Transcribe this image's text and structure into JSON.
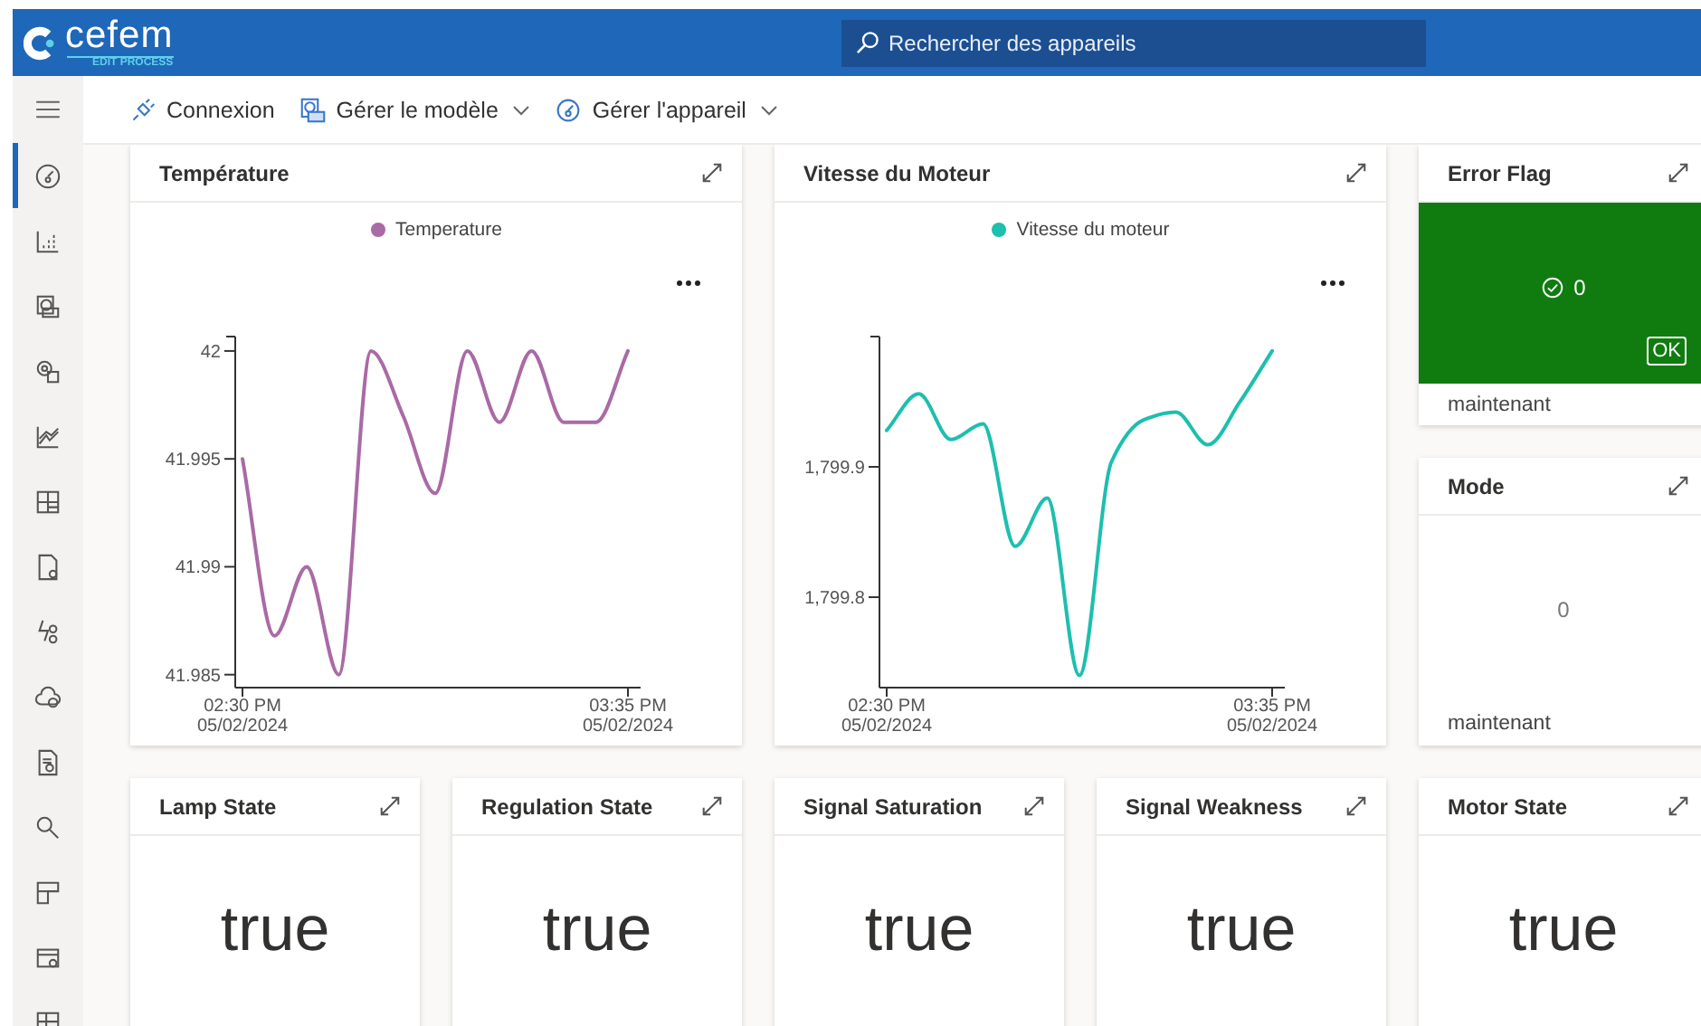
{
  "header": {
    "logo": {
      "name": "cefem",
      "tagline": "EDIT PROCESS"
    },
    "search": {
      "placeholder": "Rechercher des appareils"
    }
  },
  "sidebar": {
    "items": [
      {
        "selected": true
      },
      {
        "selected": false
      },
      {
        "selected": false
      },
      {
        "selected": false
      },
      {
        "selected": false
      },
      {
        "selected": false
      },
      {
        "selected": false
      },
      {
        "selected": false
      },
      {
        "selected": false
      },
      {
        "selected": false
      },
      {
        "selected": false
      },
      {
        "selected": false
      },
      {
        "selected": false
      },
      {
        "selected": false
      }
    ]
  },
  "commands": [
    {
      "label": "Connexion",
      "has_menu": false
    },
    {
      "label": "Gérer le modèle",
      "has_menu": true
    },
    {
      "label": "Gérer l'appareil",
      "has_menu": true
    }
  ],
  "charts": [
    {
      "title": "Température",
      "chart_data": {
        "type": "line",
        "categories": [
          "02:30 PM\n05/02/2024",
          null,
          null,
          null,
          null,
          null,
          null,
          null,
          null,
          null,
          null,
          null,
          "03:35 PM\n05/02/2024"
        ],
        "series": [
          {
            "name": "Temperature",
            "color": "#a96aa5",
            "values": [
              41.995,
              41.9868,
              41.99,
              41.985,
              42.0,
              41.997,
              41.9934,
              42.0,
              41.9967,
              42.0,
              41.9967,
              41.9967,
              42.0
            ]
          }
        ],
        "ylim": [
          41.9844,
          42.0005
        ],
        "yticks": [
          {
            "value": 41.985,
            "label": "41.985"
          },
          {
            "value": 41.99,
            "label": "41.99"
          },
          {
            "value": 41.995,
            "label": "41.995"
          },
          {
            "value": 42,
            "label": "42"
          }
        ]
      }
    },
    {
      "title": "Vitesse du Moteur",
      "chart_data": {
        "type": "line",
        "categories": [
          "02:30 PM\n05/02/2024",
          null,
          null,
          null,
          null,
          null,
          null,
          null,
          null,
          null,
          null,
          null,
          "03:35 PM\n05/02/2024"
        ],
        "series": [
          {
            "name": "Vitesse du moteur",
            "color": "#1dbfae",
            "values": [
              1799.928,
              1799.956,
              1799.921,
              1799.933,
              1799.839,
              1799.876,
              1799.74,
              1799.904,
              1799.936,
              1799.942,
              1799.917,
              1799.95,
              1799.989
            ]
          }
        ],
        "ylim": [
          1799.7306,
          1799.9972
        ],
        "yticks": [
          {
            "value": 1799.8,
            "label": "1,799.8"
          },
          {
            "value": 1799.9,
            "label": "1,799.9"
          }
        ]
      }
    }
  ],
  "side_tiles": [
    {
      "kind": "flag",
      "title": "Error Flag",
      "value": "0",
      "ok": true,
      "badge": "OK",
      "footer": "maintenant"
    },
    {
      "kind": "value",
      "title": "Mode",
      "value": "0",
      "footer": "maintenant"
    }
  ],
  "state_tiles": [
    {
      "title": "Lamp State",
      "value": "true"
    },
    {
      "title": "Regulation State",
      "value": "true"
    },
    {
      "title": "Signal Saturation",
      "value": "true"
    },
    {
      "title": "Signal Weakness",
      "value": "true"
    },
    {
      "title": "Motor State",
      "value": "true"
    }
  ]
}
